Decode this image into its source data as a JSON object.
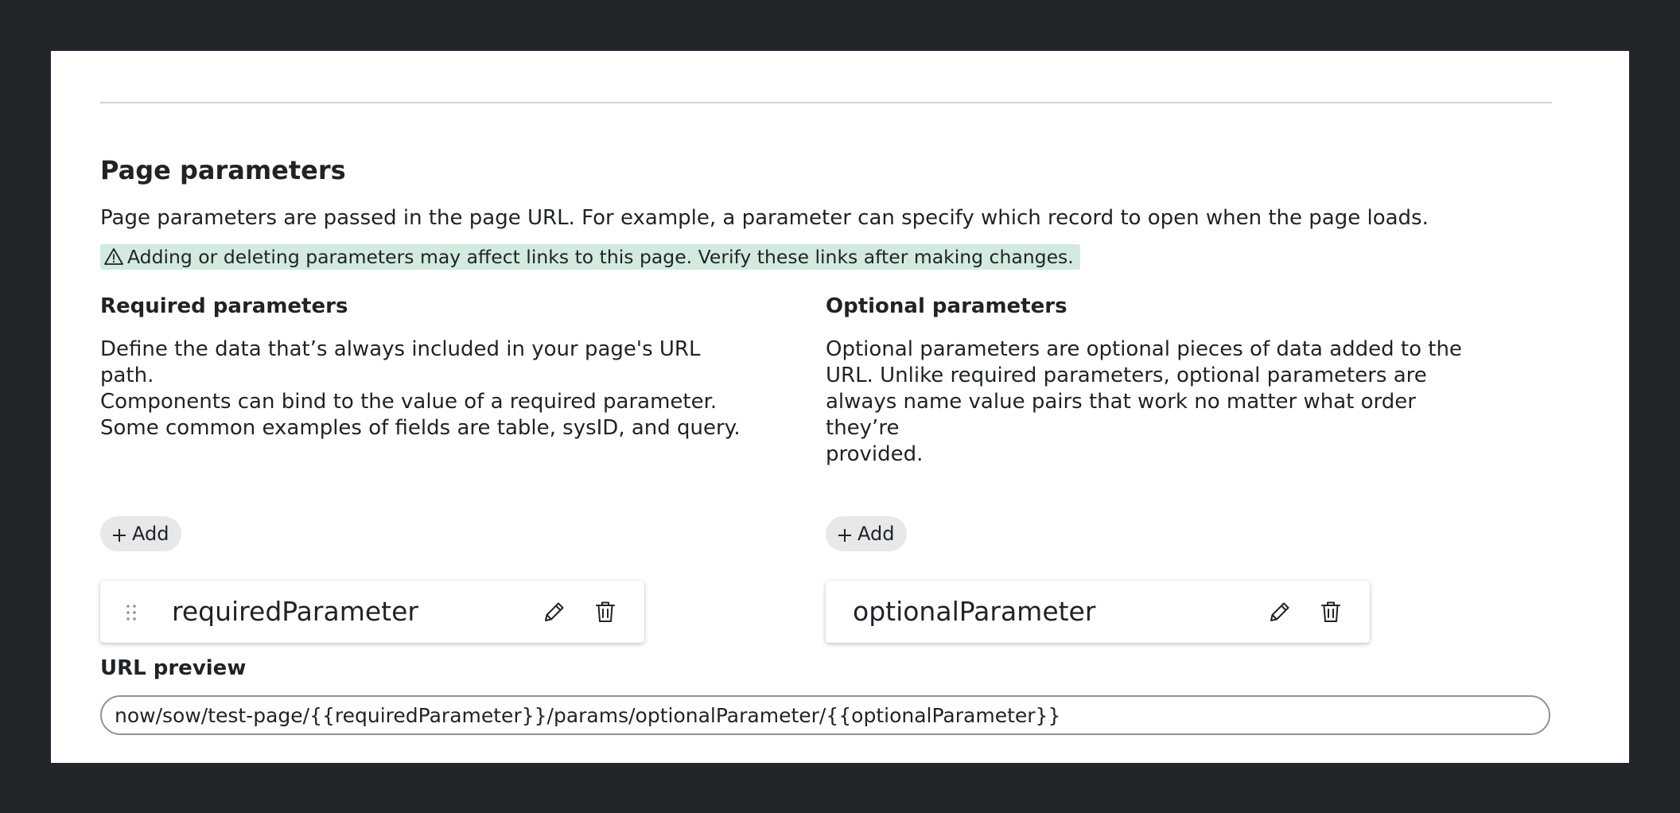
{
  "page_parameters": {
    "title": "Page parameters",
    "description": "Page parameters are passed in the page URL. For example, a parameter can specify which record to open when the page loads.",
    "warning": "Adding or deleting parameters may affect links to this page. Verify these links after making changes.",
    "warning_icon": "warning-triangle-icon",
    "warning_bg_color": "#d3eadf"
  },
  "required": {
    "title": "Required parameters",
    "description": "Define the data that’s always included in your page's URL path.\nComponents can bind to the value of a required parameter.\nSome common examples of fields are table, sysID, and query.",
    "add_label": "Add",
    "parameter": {
      "name": "requiredParameter",
      "drag_icon": "drag-handle-icon",
      "edit_icon": "pencil-icon",
      "delete_icon": "trash-icon"
    }
  },
  "optional": {
    "title": "Optional parameters",
    "description": "Optional parameters are optional pieces of data added to the\nURL. Unlike required parameters, optional parameters are\nalways name value pairs that work no matter what order they’re\nprovided.",
    "add_label": "Add",
    "parameter": {
      "name": "optionalParameter",
      "edit_icon": "pencil-icon",
      "delete_icon": "trash-icon"
    }
  },
  "url_preview": {
    "title": "URL preview",
    "value": "now/sow/test-page/{{requiredParameter}}/params/optionalParameter/{{optionalParameter}}"
  }
}
